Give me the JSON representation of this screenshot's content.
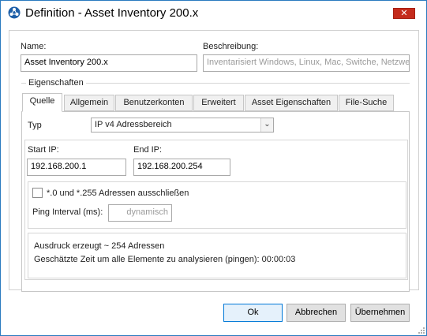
{
  "window": {
    "title": "Definition - Asset Inventory 200.x",
    "close_label": "✕"
  },
  "form": {
    "name_label": "Name:",
    "name_value": "Asset Inventory 200.x",
    "description_label": "Beschreibung:",
    "description_placeholder": "Inventarisiert Windows, Linux, Mac, Switche, Netzwe"
  },
  "group": {
    "title": "Eigenschaften"
  },
  "tabs": [
    {
      "label": "Quelle",
      "active": true
    },
    {
      "label": "Allgemein"
    },
    {
      "label": "Benutzerkonten"
    },
    {
      "label": "Erweitert"
    },
    {
      "label": "Asset Eigenschaften"
    },
    {
      "label": "File-Suche"
    }
  ],
  "source": {
    "type_label": "Typ",
    "type_value": "IP v4 Adressbereich",
    "start_ip_label": "Start IP:",
    "start_ip_value": "192.168.200.1",
    "end_ip_label": "End IP:",
    "end_ip_value": "192.168.200.254",
    "exclude_label": "*.0 und *.255 Adressen ausschließen",
    "exclude_checked": false,
    "ping_label": "Ping Interval (ms):",
    "ping_placeholder": "dynamisch",
    "summary_line1": "Ausdruck erzeugt ~ 254 Adressen",
    "summary_line2": "Geschätzte Zeit um alle Elemente zu analysieren (pingen): 00:00:03"
  },
  "buttons": {
    "ok": "Ok",
    "cancel": "Abbrechen",
    "apply": "Übernehmen"
  },
  "colors": {
    "accent": "#0078d7",
    "close": "#c42b1c",
    "border": "#2b7bc0"
  }
}
